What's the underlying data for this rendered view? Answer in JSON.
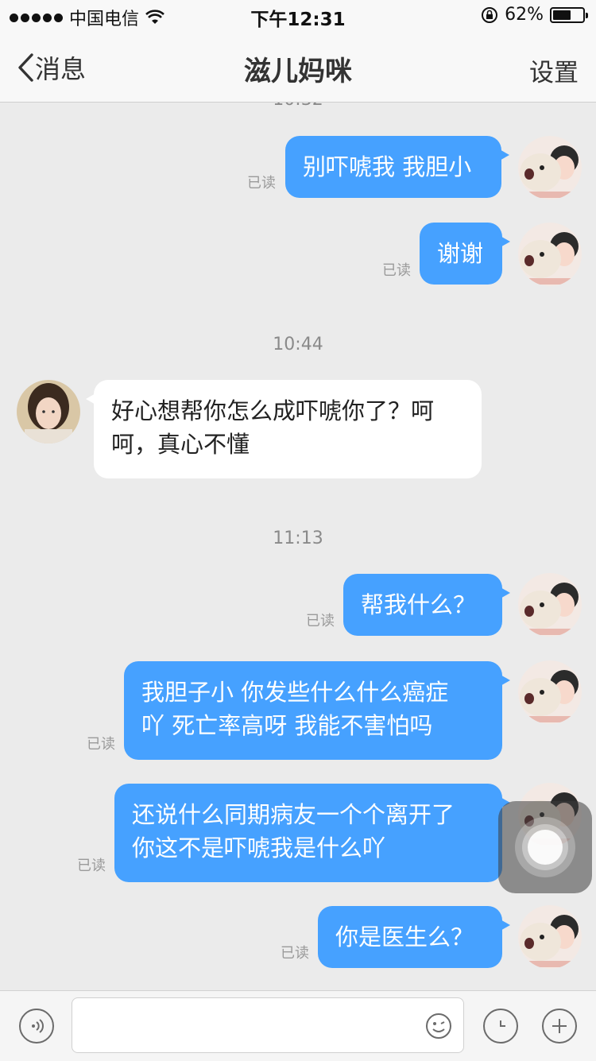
{
  "status_bar": {
    "carrier": "中国电信",
    "time": "下午12:31",
    "battery_text": "62%",
    "battery_level": 0.62
  },
  "nav": {
    "back_label": "消息",
    "title": "滋儿妈咪",
    "right_label": "设置"
  },
  "chat": {
    "timestamps": [
      "10:32",
      "10:44",
      "11:13"
    ],
    "read_label": "已读",
    "messages": [
      {
        "sender": "me",
        "text": "别吓唬我 我胆小"
      },
      {
        "sender": "me",
        "text": "谢谢"
      },
      {
        "sender": "other",
        "lines": [
          "好心想帮你怎么成吓唬你了？呵",
          "呵，真心不懂"
        ]
      },
      {
        "sender": "me",
        "text": "帮我什么？"
      },
      {
        "sender": "me",
        "lines": [
          "我胆子小 你发些什么什么癌症",
          "吖 死亡率高呀 我能不害怕吗"
        ]
      },
      {
        "sender": "me",
        "lines": [
          "还说什么同期病友一个个离开了",
          "你这不是吓唬我是什么吖"
        ]
      },
      {
        "sender": "me",
        "text": "你是医生么？"
      }
    ]
  },
  "input": {
    "placeholder": ""
  },
  "colors": {
    "bubble_me": "#46a1ff",
    "bubble_other": "#ffffff",
    "background": "#ebebeb"
  }
}
